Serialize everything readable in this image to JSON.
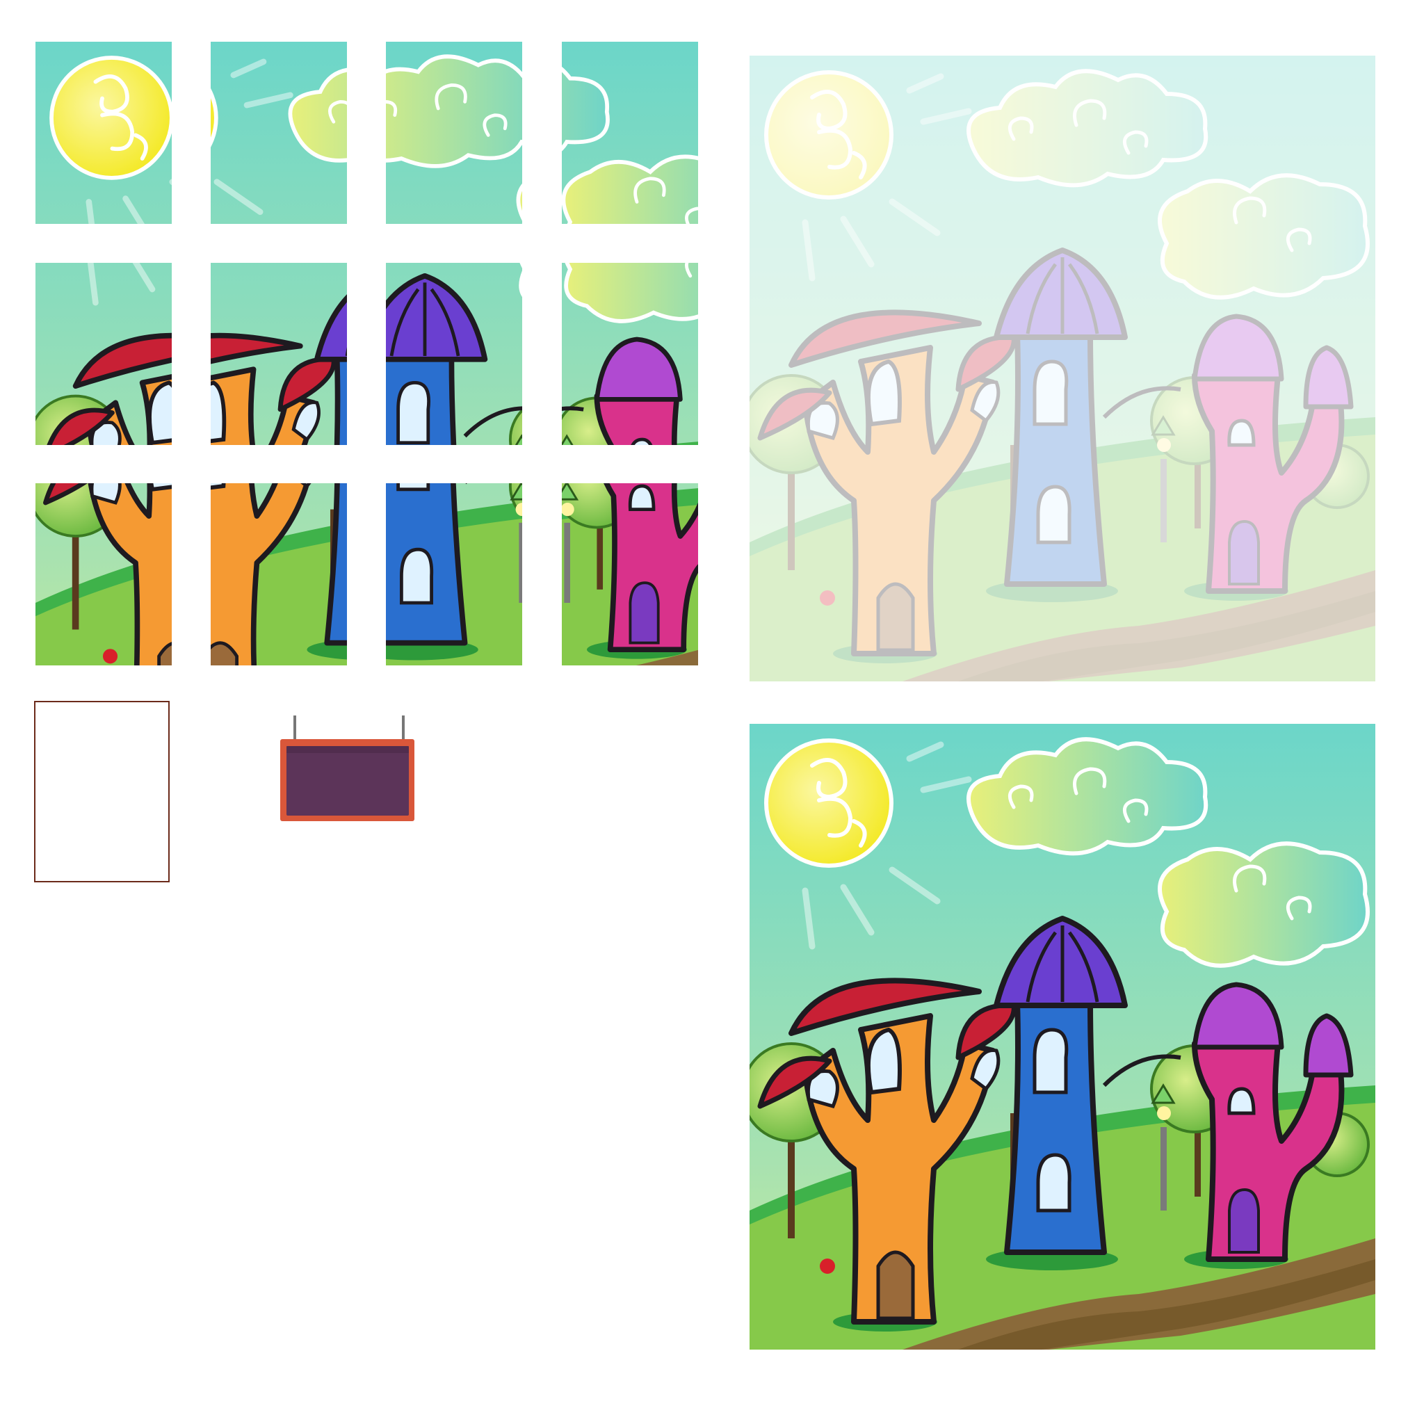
{
  "puzzle": {
    "grid_rows": 3,
    "grid_cols": 4,
    "tiles": [
      {
        "id": "r1c1",
        "row": 1,
        "col": 1
      },
      {
        "id": "r1c2",
        "row": 1,
        "col": 2
      },
      {
        "id": "r1c3",
        "row": 1,
        "col": 3
      },
      {
        "id": "r1c4",
        "row": 1,
        "col": 4
      },
      {
        "id": "r2c1",
        "row": 2,
        "col": 1
      },
      {
        "id": "r2c2",
        "row": 2,
        "col": 2
      },
      {
        "id": "r2c3",
        "row": 2,
        "col": 3
      },
      {
        "id": "r2c4",
        "row": 2,
        "col": 4
      },
      {
        "id": "r3c1",
        "row": 3,
        "col": 1
      },
      {
        "id": "r3c2",
        "row": 3,
        "col": 2
      },
      {
        "id": "r3c3",
        "row": 3,
        "col": 3
      },
      {
        "id": "r3c4",
        "row": 3,
        "col": 4
      }
    ],
    "empty_slot_border_color": "#6b2a1a"
  },
  "sign": {
    "text": "",
    "board_color": "#5c3459",
    "frame_color": "#d9573a"
  },
  "scene": {
    "name": "fairytale-mushroom-houses",
    "ghost_opacity": 0.35,
    "colors": {
      "sky_top": "#6cd6c9",
      "sky_bottom": "#b9e7a8",
      "sun": "#f6ef3a",
      "grass": "#7cc444",
      "path": "#8a6a3a",
      "orange_house": "#f59a33",
      "blue_house": "#2a6fcf",
      "pink_house": "#d9328b",
      "red_roof": "#c82035",
      "violet_roof": "#6a3fd0",
      "purple_roof": "#b04ad1"
    }
  }
}
